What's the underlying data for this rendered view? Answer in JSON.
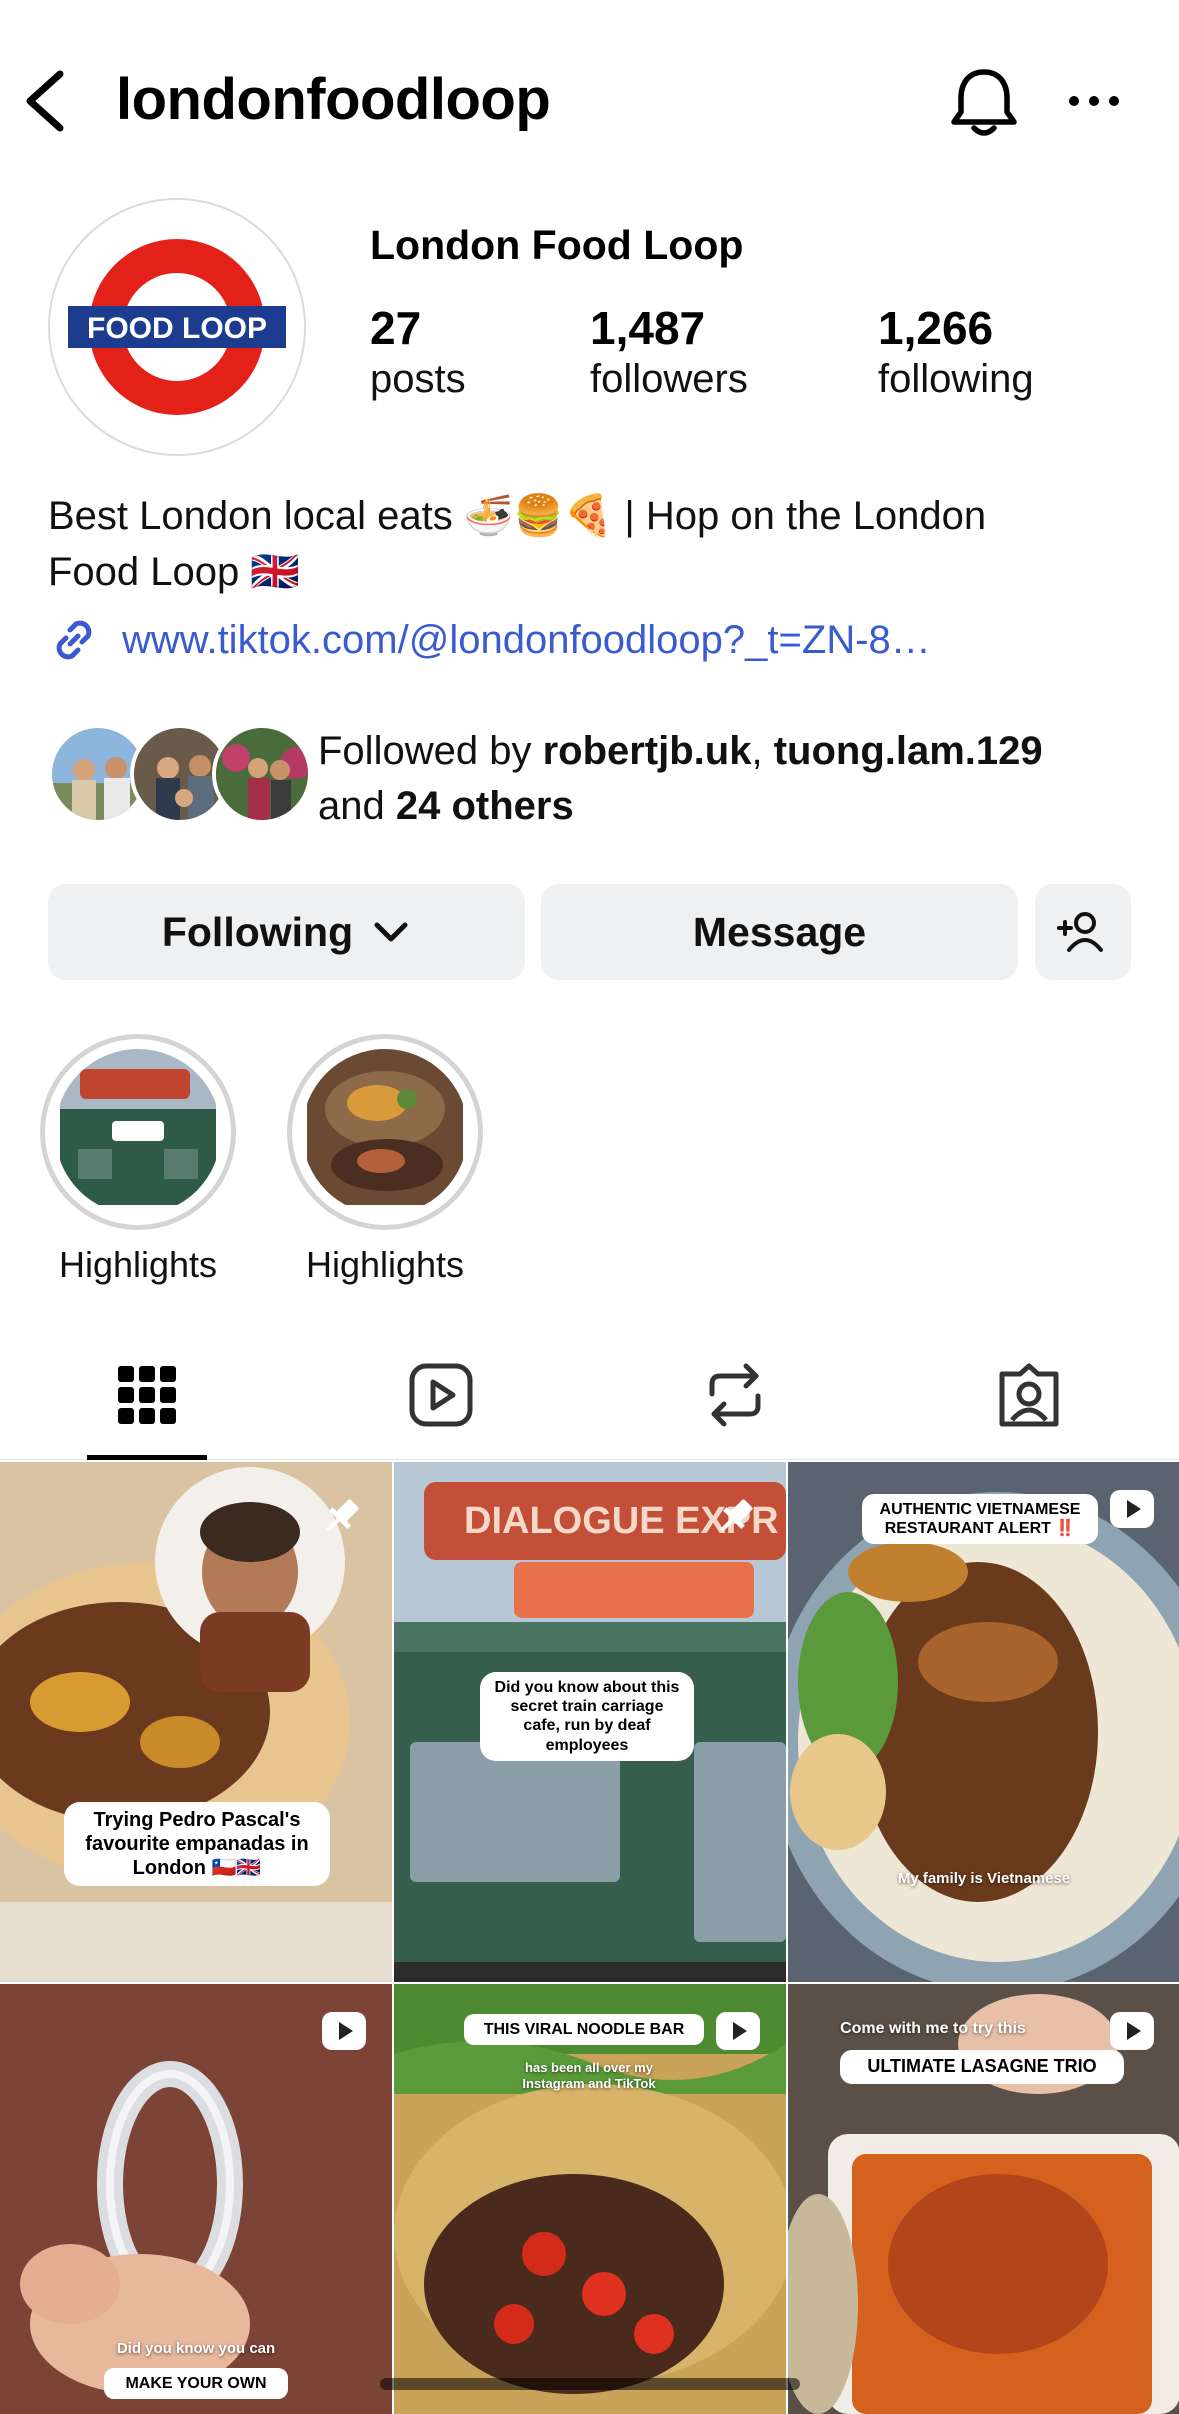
{
  "header": {
    "username": "londonfoodloop",
    "back_icon": "chevron-left-icon",
    "bell_icon": "bell-icon",
    "more_icon": "more-horizontal-icon"
  },
  "profile": {
    "display_name": "London Food Loop",
    "avatar_logo_text": "FOOD LOOP",
    "stats": {
      "posts": {
        "value": "27",
        "label": "posts"
      },
      "followers": {
        "value": "1,487",
        "label": "followers"
      },
      "following": {
        "value": "1,266",
        "label": "following"
      }
    },
    "bio_line1": "Best London local eats 🍜🍔🍕 | Hop on the London",
    "bio_line2": "Food Loop 🇬🇧",
    "link": "www.tiktok.com/@londonfoodloop?_t=ZN-8…",
    "followed_by": {
      "prefix": "Followed by ",
      "user1": "robertjb.uk",
      "sep": ", ",
      "user2": "tuong.lam.129",
      "and": "and ",
      "others": "24 others"
    }
  },
  "actions": {
    "following_label": "Following",
    "message_label": "Message",
    "add_person_icon": "add-person-icon"
  },
  "highlights": [
    {
      "label": "Highlights"
    },
    {
      "label": "Highlights"
    }
  ],
  "tabs": [
    {
      "icon": "grid-icon",
      "active": true
    },
    {
      "icon": "reels-icon",
      "active": false
    },
    {
      "icon": "reposts-icon",
      "active": false
    },
    {
      "icon": "tagged-icon",
      "active": false
    }
  ],
  "posts": [
    {
      "caption": "Trying Pedro Pascal's favourite empanadas in London 🇨🇱🇬🇧",
      "pinned": true
    },
    {
      "top_sign": "DIALOGUE EXPR",
      "caption": "Did you know about this secret train carriage cafe, run by deaf employees",
      "pinned": true
    },
    {
      "caption": "AUTHENTIC VIETNAMESE RESTAURANT ALERT ‼️",
      "overlay": "My family is Vietnamese",
      "reel": true
    },
    {
      "overlay": "Did you know you can",
      "caption": "MAKE YOUR OWN",
      "reel": true
    },
    {
      "caption": "THIS VIRAL NOODLE BAR",
      "overlay": "has been all over my Instagram and TikTok",
      "reel": true
    },
    {
      "overlay": "Come with me to try this",
      "caption": "ULTIMATE LASAGNE TRIO",
      "reel": true
    }
  ],
  "colors": {
    "accent_link": "#3a5ad0",
    "button_bg": "#eef0f2",
    "roundel_red": "#e32119",
    "roundel_blue": "#1d3c8f"
  }
}
